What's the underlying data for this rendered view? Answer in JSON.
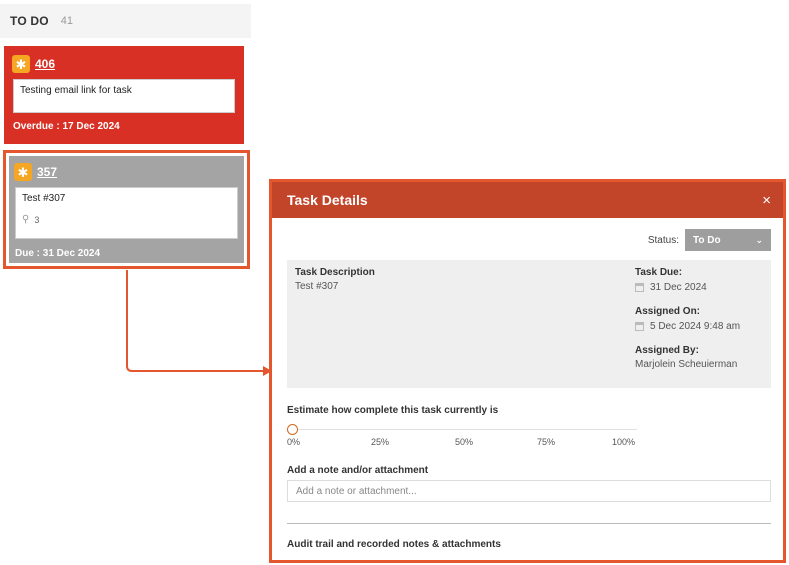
{
  "column": {
    "title": "TO DO",
    "count": "41"
  },
  "cards": [
    {
      "id": "406",
      "description": "Testing email link for task",
      "footer": "Overdue : 17 Dec 2024",
      "icon": "task-type-icon",
      "color": "#d93025"
    },
    {
      "id": "357",
      "description": "Test #307",
      "attachments": "3",
      "footer": "Due : 31 Dec 2024",
      "icon": "task-type-icon",
      "color": "#a4a4a4"
    }
  ],
  "modal": {
    "title": "Task Details",
    "close": "×",
    "status": {
      "label": "Status:",
      "value": "To Do"
    },
    "details": {
      "description_label": "Task Description",
      "description_value": "Test #307",
      "due_label": "Task Due:",
      "due_value": "31 Dec 2024",
      "assigned_on_label": "Assigned On:",
      "assigned_on_value": "5 Dec 2024 9:48 am",
      "assigned_by_label": "Assigned By:",
      "assigned_by_value": "Marjolein Scheuierman"
    },
    "estimate": {
      "label": "Estimate how complete this task currently is",
      "value_percent": 0,
      "ticks": [
        "0%",
        "25%",
        "50%",
        "75%",
        "100%"
      ]
    },
    "note": {
      "label": "Add a note and/or attachment",
      "placeholder": "Add a note or attachment..."
    },
    "audit_label": "Audit trail and recorded notes & attachments"
  },
  "colors": {
    "accent": "#e4572e",
    "header": "#c2452a",
    "overdue": "#d93025",
    "card_grey": "#a4a4a4"
  }
}
